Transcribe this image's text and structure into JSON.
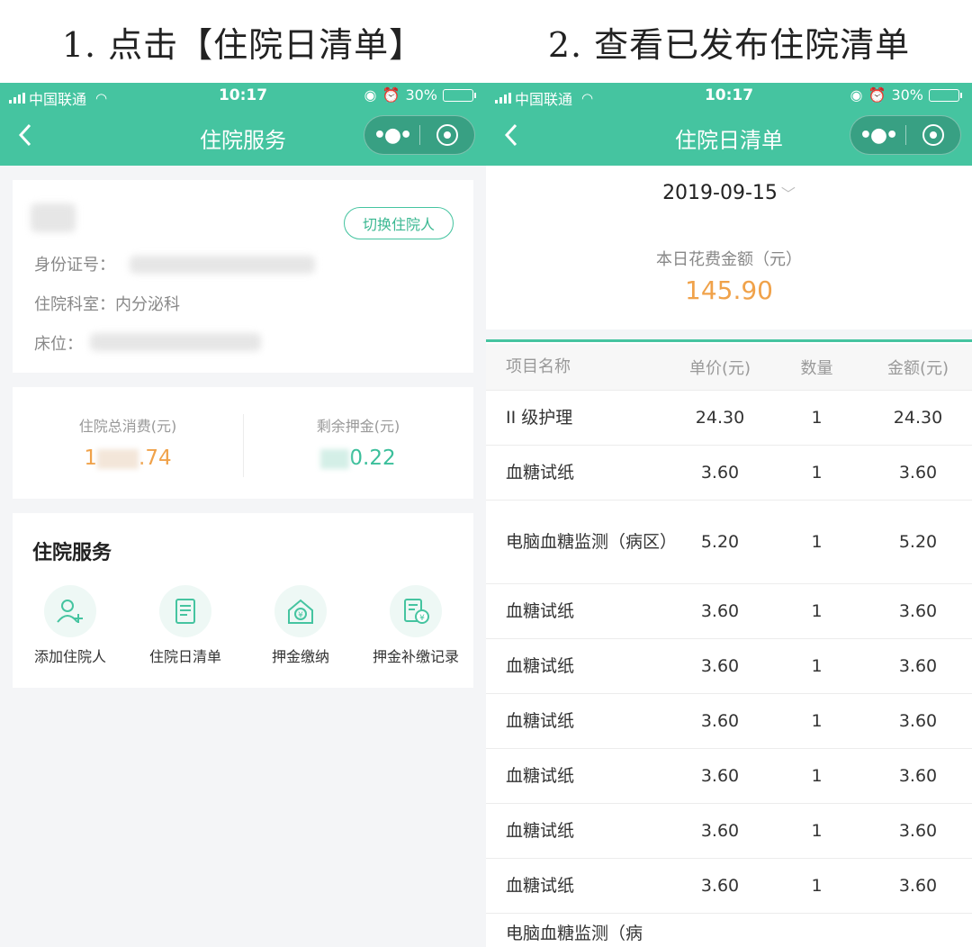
{
  "captions": {
    "left": "1. 点击【住院日清单】",
    "right": "2. 查看已发布住院清单"
  },
  "status_bar": {
    "carrier": "中国联通",
    "time": "10:17",
    "battery": "30%"
  },
  "left_screen": {
    "nav_title": "住院服务",
    "switch_button": "切换住院人",
    "id_label": "身份证号：",
    "dept_label": "住院科室：",
    "dept_value": "内分泌科",
    "bed_label": "床位：",
    "total_label": "住院总消费(元)",
    "total_value_prefix": "1",
    "total_value_suffix": ".74",
    "deposit_label": "剩余押金(元)",
    "deposit_value_suffix": "0.22",
    "services_title": "住院服务",
    "services": [
      {
        "label": "添加住院人",
        "icon": "add-user-icon"
      },
      {
        "label": "住院日清单",
        "icon": "list-icon"
      },
      {
        "label": "押金缴纳",
        "icon": "house-yen-icon"
      },
      {
        "label": "押金补缴记录",
        "icon": "record-yen-icon"
      }
    ]
  },
  "right_screen": {
    "nav_title": "住院日清单",
    "date": "2019-09-15",
    "day_total_label": "本日花费金额（元）",
    "day_total_value": "145.90",
    "table": {
      "headers": [
        "项目名称",
        "单价(元)",
        "数量",
        "金额(元)"
      ],
      "rows": [
        [
          "II 级护理",
          "24.30",
          "1",
          "24.30"
        ],
        [
          "血糖试纸",
          "3.60",
          "1",
          "3.60"
        ],
        [
          "电脑血糖监测（病区）",
          "5.20",
          "1",
          "5.20"
        ],
        [
          "血糖试纸",
          "3.60",
          "1",
          "3.60"
        ],
        [
          "血糖试纸",
          "3.60",
          "1",
          "3.60"
        ],
        [
          "血糖试纸",
          "3.60",
          "1",
          "3.60"
        ],
        [
          "血糖试纸",
          "3.60",
          "1",
          "3.60"
        ],
        [
          "血糖试纸",
          "3.60",
          "1",
          "3.60"
        ],
        [
          "血糖试纸",
          "3.60",
          "1",
          "3.60"
        ],
        [
          "电脑血糖监测（病",
          "",
          "",
          ""
        ]
      ]
    }
  },
  "colors": {
    "brand": "#45c4a0",
    "amount_orange": "#f0a24a",
    "amount_teal": "#3bbf9b"
  }
}
